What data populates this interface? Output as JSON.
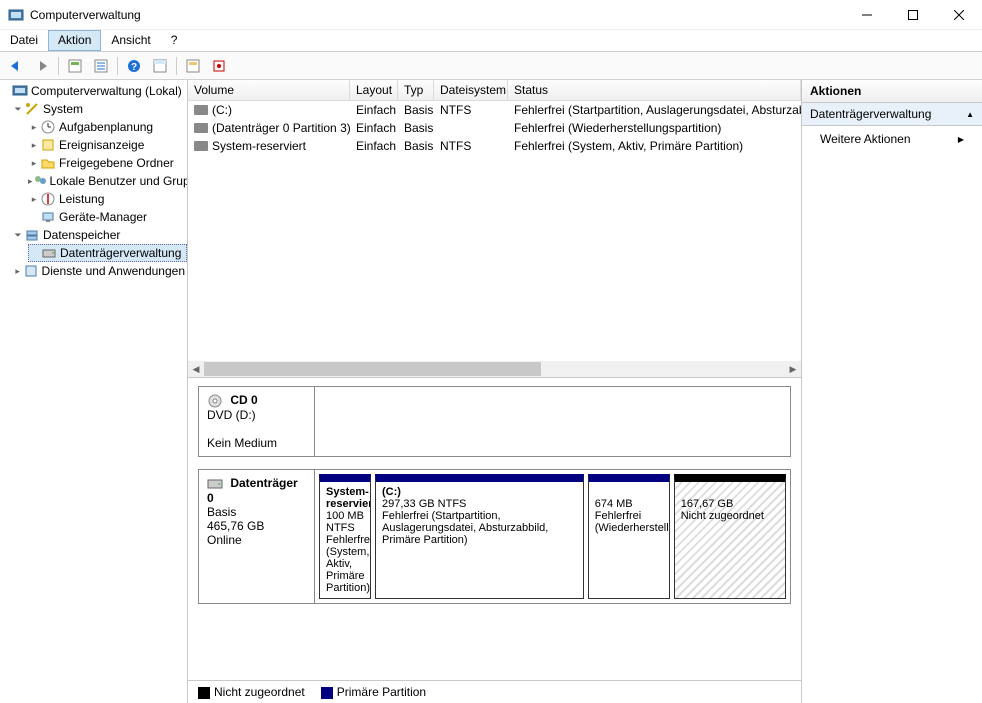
{
  "window": {
    "title": "Computerverwaltung"
  },
  "menu": {
    "datei": "Datei",
    "aktion": "Aktion",
    "ansicht": "Ansicht",
    "help": "?"
  },
  "tree": {
    "root": "Computerverwaltung (Lokal)",
    "system": "System",
    "aufgaben": "Aufgabenplanung",
    "ereignis": "Ereignisanzeige",
    "freigabe": "Freigegebene Ordner",
    "benutzer": "Lokale Benutzer und Gruppen",
    "leistung": "Leistung",
    "geraete": "Geräte-Manager",
    "datenspeicher": "Datenspeicher",
    "dtv": "Datenträgerverwaltung",
    "dienste": "Dienste und Anwendungen"
  },
  "volumes": {
    "headers": {
      "volume": "Volume",
      "layout": "Layout",
      "typ": "Typ",
      "fs": "Dateisystem",
      "status": "Status"
    },
    "rows": [
      {
        "name": "(C:)",
        "layout": "Einfach",
        "typ": "Basis",
        "fs": "NTFS",
        "status": "Fehlerfrei (Startpartition, Auslagerungsdatei, Absturzabbild, Primäre Partition)"
      },
      {
        "name": "(Datenträger 0 Partition 3)",
        "layout": "Einfach",
        "typ": "Basis",
        "fs": "",
        "status": "Fehlerfrei (Wiederherstellungspartition)"
      },
      {
        "name": "System-reserviert",
        "layout": "Einfach",
        "typ": "Basis",
        "fs": "NTFS",
        "status": "Fehlerfrei (System, Aktiv, Primäre Partition)"
      }
    ]
  },
  "disks": {
    "cd": {
      "title": "CD 0",
      "line1": "DVD (D:)",
      "line2": "Kein Medium"
    },
    "d0": {
      "title": "Datenträger 0",
      "type": "Basis",
      "size": "465,76 GB",
      "state": "Online",
      "p1": {
        "name": "System-reserviert",
        "size": "100 MB NTFS",
        "status": "Fehlerfrei (System, Aktiv, Primäre Partition)"
      },
      "p2": {
        "name": "(C:)",
        "size": "297,33 GB NTFS",
        "status": "Fehlerfrei (Startpartition, Auslagerungsdatei, Absturzabbild, Primäre Partition)"
      },
      "p3": {
        "name": "",
        "size": "674 MB",
        "status": "Fehlerfrei (Wiederherstellungspartition)"
      },
      "p4": {
        "name": "",
        "size": "167,67 GB",
        "status": "Nicht zugeordnet"
      }
    }
  },
  "legend": {
    "unalloc": "Nicht zugeordnet",
    "primary": "Primäre Partition"
  },
  "actions": {
    "title": "Aktionen",
    "section": "Datenträgerverwaltung",
    "more": "Weitere Aktionen"
  }
}
